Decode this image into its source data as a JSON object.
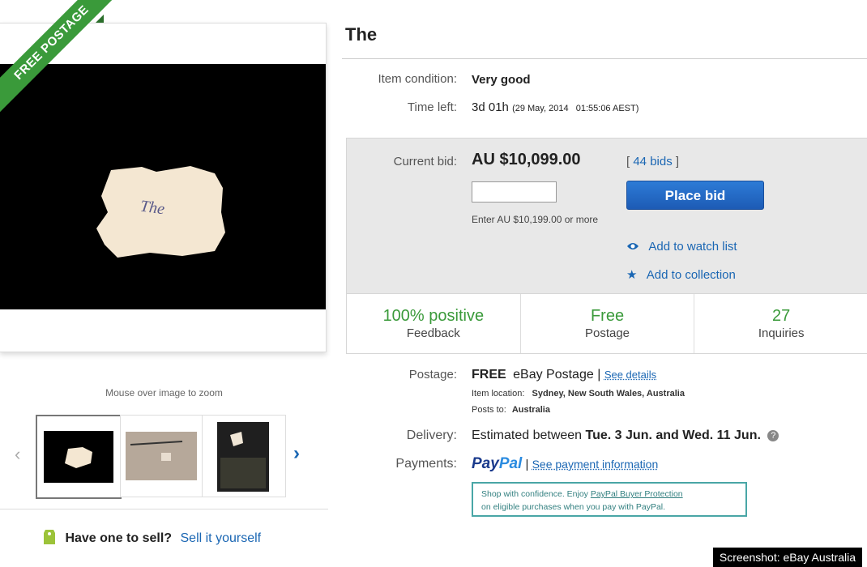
{
  "ribbon": {
    "label": "FREE POSTAGE"
  },
  "photo": {
    "note": "The"
  },
  "zoom_hint": "Mouse over image to zoom",
  "sell": {
    "question": "Have one to sell?",
    "link": "Sell it yourself"
  },
  "item": {
    "title": "The",
    "condition_label": "Item condition:",
    "condition": "Very good",
    "time_label": "Time left:",
    "time_left": "3d 01h",
    "time_end": "(29 May, 2014   01:55:06 AEST)"
  },
  "bid": {
    "label": "Current bid:",
    "amount": "AU $10,099.00",
    "bids_open": "[",
    "bids_count": "44 bids",
    "bids_close": "]",
    "input_value": "",
    "hint": "Enter AU $10,199.00 or more",
    "place_bid_label": "Place bid",
    "watch_label": "Add to watch list",
    "collection_label": "Add to collection"
  },
  "stats": [
    {
      "main": "100% positive",
      "sub": "Feedback"
    },
    {
      "main": "Free",
      "sub": "Postage"
    },
    {
      "main": "27",
      "sub": "Inquiries"
    }
  ],
  "postage": {
    "label": "Postage:",
    "free": "FREE",
    "service": "eBay Postage",
    "sep": "|",
    "details_link": "See details",
    "location_label": "Item location:",
    "location": "Sydney, New South Wales, Australia",
    "posts_label": "Posts to:",
    "posts_to": "Australia"
  },
  "delivery": {
    "label": "Delivery:",
    "prefix": "Estimated between",
    "start": "Tue. 3 Jun.",
    "and": "and",
    "end": "Wed. 11 Jun.",
    "help_icon": "?"
  },
  "payments": {
    "label": "Payments:",
    "paypal_a": "Pay",
    "paypal_b": "Pal",
    "sep": "|",
    "info_link": "See payment information",
    "confidence_a": "Shop with confidence. Enjoy",
    "confidence_link": "PayPal Buyer Protection",
    "confidence_b": "on eligible purchases when you pay with PayPal."
  },
  "credit": "Screenshot: eBay Australia",
  "colors": {
    "accent_green": "#3a9a3a",
    "link_blue": "#1a66b3",
    "button_blue": "#1d5bb5"
  }
}
